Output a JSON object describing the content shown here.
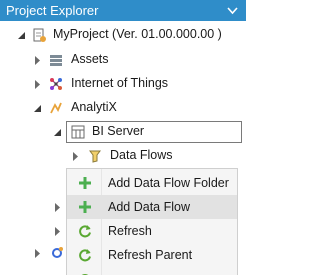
{
  "panel": {
    "title": "Project Explorer",
    "dropdown_icon": "chevron-down-icon"
  },
  "tree": {
    "project": {
      "label": "MyProject (Ver. 01.00.000.00 )",
      "icon": "project-icon",
      "expanded": true
    },
    "assets": {
      "label": "Assets",
      "icon": "assets-icon",
      "expanded": false
    },
    "iot": {
      "label": "Internet of Things",
      "icon": "iot-icon",
      "expanded": false
    },
    "analytix": {
      "label": "AnalytiX",
      "icon": "analytix-icon",
      "expanded": true
    },
    "bi_server": {
      "label": "BI Server",
      "icon": "bi-server-icon",
      "expanded": true,
      "selected": true
    },
    "data_flows": {
      "label": "Data Flows",
      "icon": "data-flows-icon",
      "expanded": false
    }
  },
  "context_menu": {
    "items": [
      {
        "label": "Add Data Flow Folder",
        "icon": "add-icon"
      },
      {
        "label": "Add Data Flow",
        "icon": "add-icon",
        "highlighted": true
      },
      {
        "label": "Refresh",
        "icon": "refresh-icon"
      },
      {
        "label": "Refresh Parent",
        "icon": "refresh-icon"
      }
    ]
  },
  "colors": {
    "title_bar": "#2f8dc9",
    "add_icon": "#4caf50",
    "refresh_icon": "#5aa832",
    "menu_background": "#f5f5f5",
    "menu_highlight": "#e2e2e2"
  }
}
